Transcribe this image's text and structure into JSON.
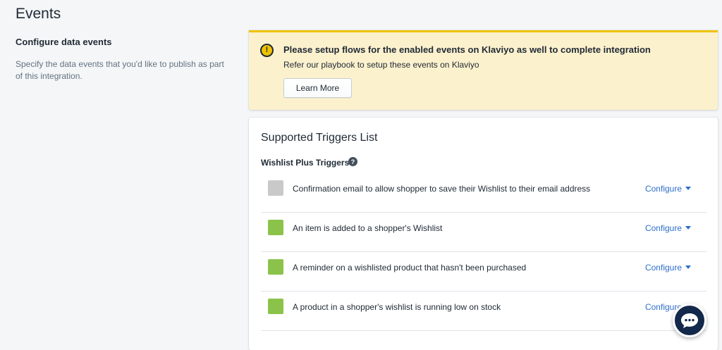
{
  "page": {
    "title": "Events"
  },
  "aside": {
    "title": "Configure data events",
    "description": "Specify the data events that you'd like to publish as part of this integration."
  },
  "banner": {
    "icon": "exclamation-circle-icon",
    "title": "Please setup flows for the enabled events on Klaviyo as well to complete integration",
    "text": "Refer our playbook to setup these events on Klaviyo",
    "button_label": "Learn More",
    "accent_color": "#eec200",
    "background_color": "#fcf1cd"
  },
  "card": {
    "title": "Supported Triggers List",
    "section_title": "Wishlist Plus Triggers",
    "help_icon": "question-circle-icon",
    "triggers": [
      {
        "label": "Confirmation email to allow shopper to save their Wishlist to their email address",
        "enabled": false,
        "action": "Configure"
      },
      {
        "label": "An item is added to a shopper's Wishlist",
        "enabled": true,
        "action": "Configure"
      },
      {
        "label": "A reminder on a wishlisted product that hasn't been purchased",
        "enabled": true,
        "action": "Configure"
      },
      {
        "label": "A product in a shopper's wishlist is running low on stock",
        "enabled": true,
        "action": "Configure"
      }
    ]
  },
  "colors": {
    "enabled": "#8bc34a",
    "disabled": "#c9c9c9",
    "link": "#2c6ecb",
    "chat": "#13294b"
  },
  "chat_widget": {
    "icon": "chat-bubble-icon"
  }
}
